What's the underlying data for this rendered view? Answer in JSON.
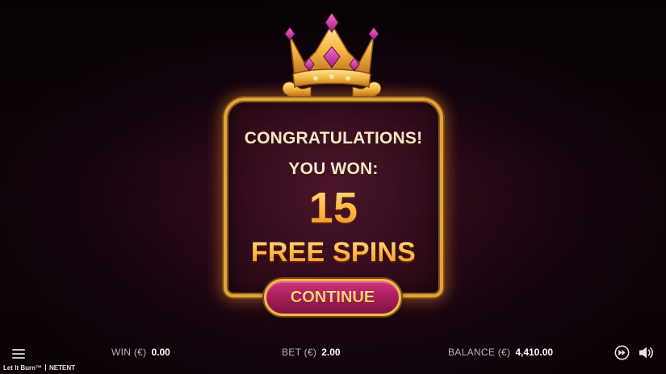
{
  "popup": {
    "congratulations": "CONGRATULATIONS!",
    "you_won": "YOU WON:",
    "count": "15",
    "prize": "FREE SPINS",
    "continue_label": "CONTINUE"
  },
  "bottom_bar": {
    "win_label": "WIN (€)",
    "win_value": "0.00",
    "bet_label": "BET (€)",
    "bet_value": "2.00",
    "balance_label": "BALANCE (€)",
    "balance_value": "4,410.00",
    "game_name": "Let It Burn™",
    "provider": "NETENT"
  },
  "icons": {
    "menu": "hamburger-menu-icon",
    "fast_forward": "fast-forward-icon",
    "sound": "speaker-icon",
    "crown": "crown-icon"
  },
  "colors": {
    "gold": "#e0a53a",
    "button_pink": "#b8245f",
    "text_gold": "#ffb640",
    "background": "#2a0a18"
  }
}
